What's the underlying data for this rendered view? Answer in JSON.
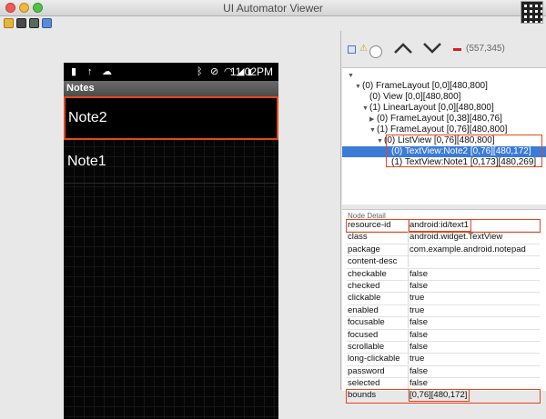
{
  "window": {
    "title": "UI Automator Viewer"
  },
  "phone": {
    "status_time": "11:02PM",
    "app_title": "Notes",
    "notes": [
      "Note2",
      "Note1"
    ]
  },
  "tree_toolbar": {
    "coords": "(557,345)"
  },
  "tree": [
    {
      "text": "(0) FrameLayout [0,0][480,800]",
      "indent": 1,
      "twisty": "▼"
    },
    {
      "text": "(0) View [0,0][480,800]",
      "indent": 2,
      "twisty": ""
    },
    {
      "text": "(1) LinearLayout [0,0][480,800]",
      "indent": 2,
      "twisty": "▼"
    },
    {
      "text": "(0) FrameLayout [0,38][480,76]",
      "indent": 3,
      "twisty": "▶"
    },
    {
      "text": "(1) FrameLayout [0,76][480,800]",
      "indent": 3,
      "twisty": "▼"
    },
    {
      "text": "(0) ListView [0,76][480,800]",
      "indent": 4,
      "twisty": "▼"
    },
    {
      "text": "(0) TextView:Note2 [0,76][480,172]",
      "indent": 5,
      "twisty": "",
      "selected": true
    },
    {
      "text": "(1) TextView:Note1 [0,173][480,269]",
      "indent": 5,
      "twisty": ""
    }
  ],
  "node_detail": {
    "header": "Node Detail",
    "rows": [
      {
        "key": "resource-id",
        "value": "android:id/text1",
        "highlight": true
      },
      {
        "key": "class",
        "value": "android.widget.TextView"
      },
      {
        "key": "package",
        "value": "com.example.android.notepad"
      },
      {
        "key": "content-desc",
        "value": ""
      },
      {
        "key": "checkable",
        "value": "false"
      },
      {
        "key": "checked",
        "value": "false"
      },
      {
        "key": "clickable",
        "value": "true"
      },
      {
        "key": "enabled",
        "value": "true"
      },
      {
        "key": "focusable",
        "value": "false"
      },
      {
        "key": "focused",
        "value": "false"
      },
      {
        "key": "scrollable",
        "value": "false"
      },
      {
        "key": "long-clickable",
        "value": "true"
      },
      {
        "key": "password",
        "value": "false"
      },
      {
        "key": "selected",
        "value": "false"
      },
      {
        "key": "bounds",
        "value": "[0,76][480,172]",
        "highlight": true
      }
    ]
  },
  "colors": {
    "highlight": "#e8461c",
    "selection": "#3c7bd8"
  }
}
